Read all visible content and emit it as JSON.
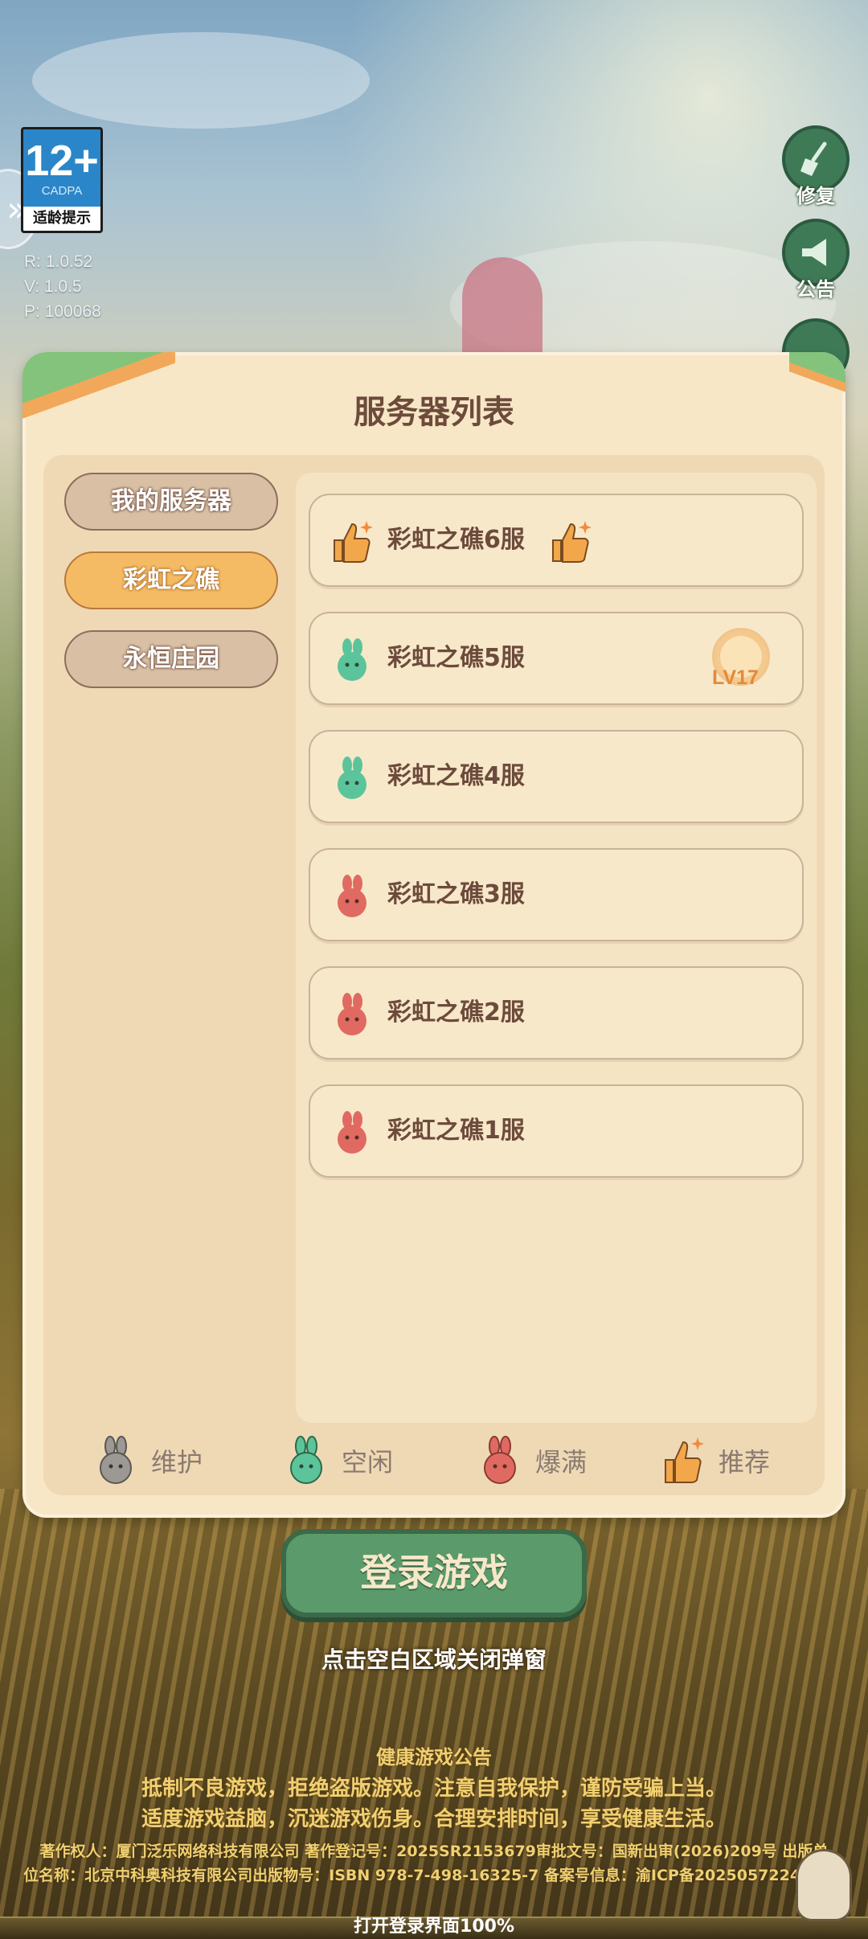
{
  "age_rating": {
    "number": "12+",
    "org": "CADPA",
    "tip": "适龄提示"
  },
  "version": {
    "r": "R:  1.0.52",
    "v": "V:  1.0.5",
    "p": "P:  100068"
  },
  "right_buttons": {
    "repair": "修复",
    "notice": "公告"
  },
  "panel": {
    "title": "服务器列表",
    "tabs": [
      {
        "label": "我的服务器",
        "active": false
      },
      {
        "label": "彩虹之礁",
        "active": true
      },
      {
        "label": "永恒庄园",
        "active": false
      }
    ],
    "servers": [
      {
        "name": "彩虹之礁6服",
        "status": "recommend"
      },
      {
        "name": "彩虹之礁5服",
        "status": "idle",
        "level_badge": "LV17"
      },
      {
        "name": "彩虹之礁4服",
        "status": "idle"
      },
      {
        "name": "彩虹之礁3服",
        "status": "full"
      },
      {
        "name": "彩虹之礁2服",
        "status": "full"
      },
      {
        "name": "彩虹之礁1服",
        "status": "full"
      }
    ],
    "legend": [
      {
        "label": "维护",
        "color": "#9c9894"
      },
      {
        "label": "空闲",
        "color": "#5cc49a"
      },
      {
        "label": "爆满",
        "color": "#e06a62"
      },
      {
        "label": "推荐",
        "color": "#f2a84a"
      }
    ]
  },
  "login_button": "登录游戏",
  "close_hint": "点击空白区域关闭弹窗",
  "health_notice": {
    "title": "健康游戏公告",
    "line1": "抵制不良游戏，拒绝盗版游戏。注意自我保护，谨防受骗上当。",
    "line2": "适度游戏益脑，沉迷游戏伤身。合理安排时间，享受健康生活。"
  },
  "copyright": {
    "line1": "著作权人：厦门泛乐网络科技有限公司 著作登记号：2025SR2153679审批文号：国新出审(2026)209号 出版单",
    "line2": "位名称：北京中科奥科技有限公司出版物号：ISBN 978-7-498-16325-7 备案号信息：渝ICP备2025057224号-3A"
  },
  "progress": {
    "label": "打开登录界面100%",
    "value": 100
  },
  "colors": {
    "panel_bg": "#f7e7c6",
    "accent_orange": "#f5bb64",
    "login_green": "#5a9a6b",
    "title_brown": "#6d4b3c"
  }
}
